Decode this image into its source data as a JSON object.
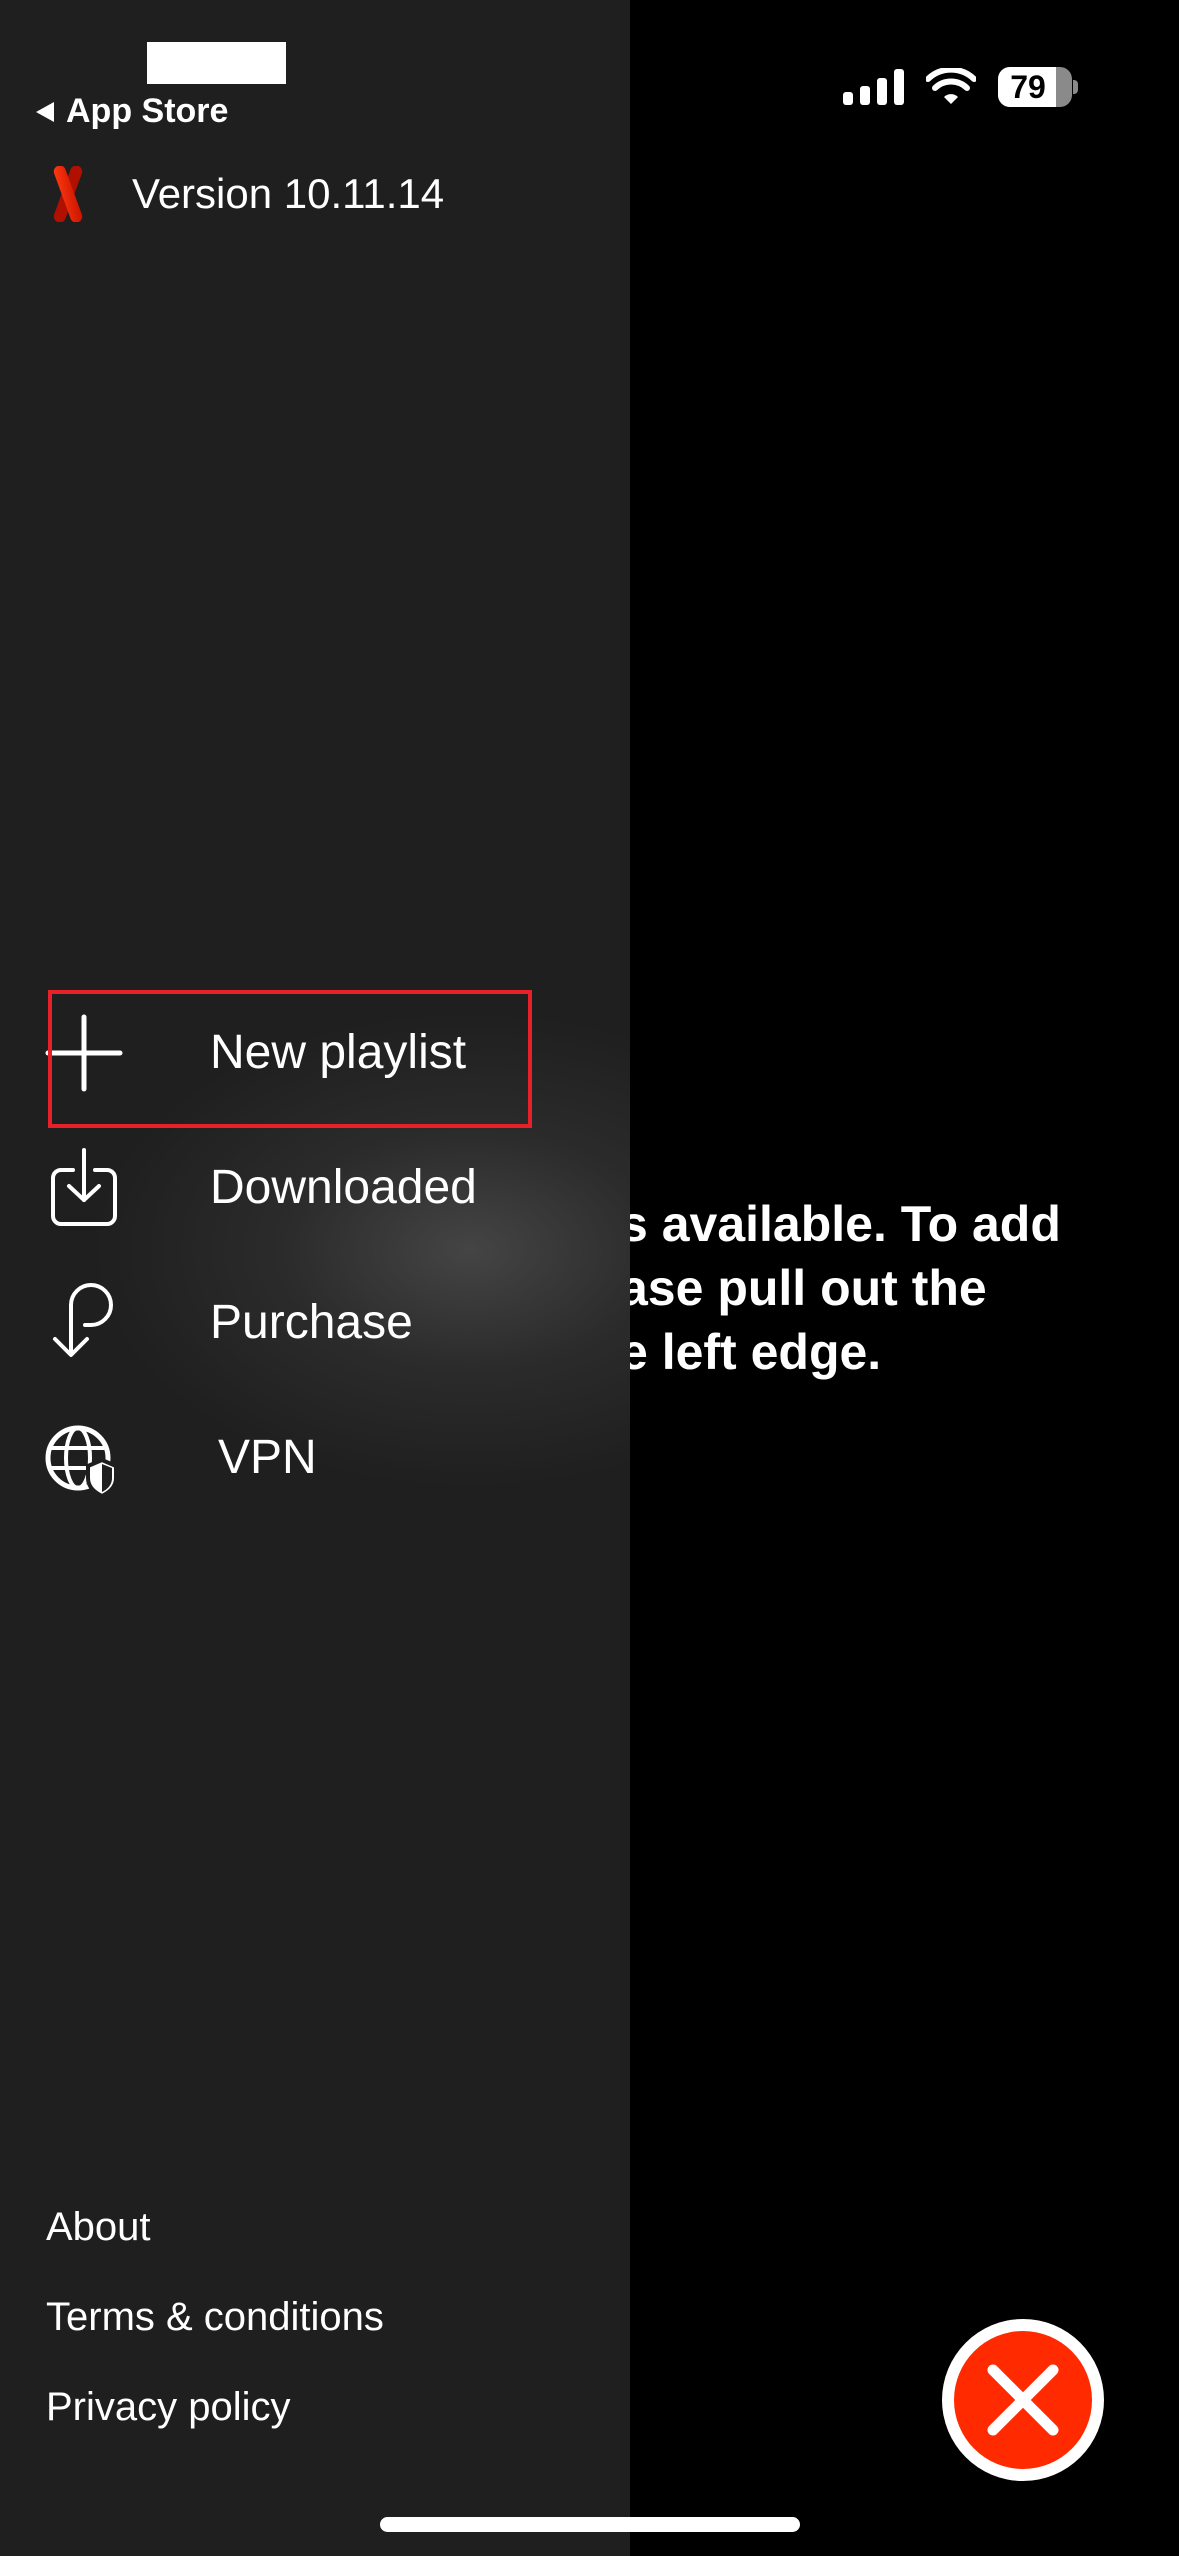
{
  "status_bar": {
    "back_label": "App Store",
    "signal_bars": 4,
    "battery_percent": "79",
    "battery_level": 0.79
  },
  "drawer": {
    "app_icon": "x-logo-icon",
    "version_label": "Version 10.11.14",
    "menu_items": [
      {
        "label": "New playlist",
        "icon": "plus-icon",
        "highlighted": true
      },
      {
        "label": "Downloaded",
        "icon": "download-icon"
      },
      {
        "label": "Purchase",
        "icon": "purchase-arrow-icon"
      },
      {
        "label": "VPN",
        "icon": "globe-shield-icon"
      }
    ],
    "footer_links": [
      {
        "label": "About"
      },
      {
        "label": "Terms & conditions"
      },
      {
        "label": "Privacy policy"
      }
    ]
  },
  "main": {
    "empty_message_visible": "s available. To add\nase pull out the\ne left edge."
  },
  "colors": {
    "drawer_bg": "#1f1f1f",
    "accent_red": "#ff2a00",
    "highlight_border": "#e8202a"
  }
}
